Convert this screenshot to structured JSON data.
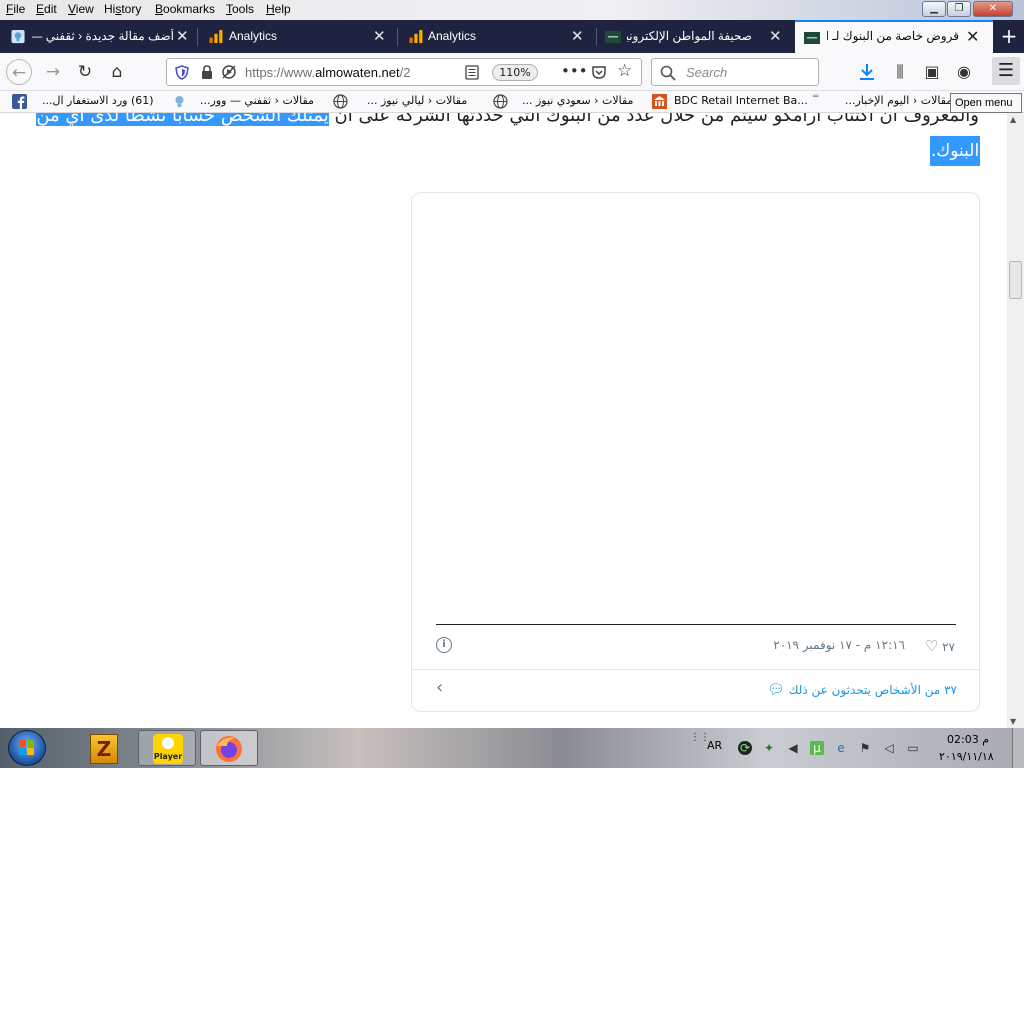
{
  "menubar": {
    "items": [
      {
        "label": "File",
        "underline": "F",
        "rest": "ile"
      },
      {
        "label": "Edit",
        "underline": "E",
        "rest": "dit"
      },
      {
        "label": "View",
        "underline": "V",
        "rest": "iew"
      },
      {
        "label": "History",
        "underline": "s",
        "pre": "Hi",
        "rest": "tory"
      },
      {
        "label": "Bookmarks",
        "underline": "B",
        "rest": "ookmarks"
      },
      {
        "label": "Tools",
        "underline": "T",
        "rest": "ools"
      },
      {
        "label": "Help",
        "underline": "H",
        "rest": "elp"
      }
    ]
  },
  "tabs": [
    {
      "label": "أضف مقالة جديدة ‹ ثقفني — و",
      "icon": "lightbulb-icon"
    },
    {
      "label": "Analytics",
      "icon": "analytics-icon"
    },
    {
      "label": "Analytics",
      "icon": "analytics-icon"
    },
    {
      "label": "صحيفة المواطن الإلكترونية",
      "icon": "almowaten-icon"
    },
    {
      "label": "قروض خاصة من البنوك لـ اكتتا",
      "icon": "almowaten-icon",
      "active": true
    }
  ],
  "navbar": {
    "url_scheme": "https://www.",
    "url_host": "almowaten.net",
    "url_path": "/2",
    "zoom": "110%",
    "search_placeholder": "Search"
  },
  "bookmarks": [
    {
      "label": "(61) ورد الاستغفار ال...",
      "icon": "facebook-icon"
    },
    {
      "label": "مقالات ‹ ثقفني — وور...",
      "icon": "lightbulb-icon"
    },
    {
      "label": "مقالات ‹ ليالي نيوز ...",
      "icon": "globe-icon"
    },
    {
      "label": "مقالات ‹ سعودي نيوز ...",
      "icon": "globe-icon"
    },
    {
      "label": "BDC Retail Internet Ba...",
      "icon": "bank-icon"
    },
    {
      "label": "مقالات ‹ اليوم الإخبار...",
      "icon": "dash-icon"
    }
  ],
  "tooltip": "Open menu",
  "article": {
    "line1_plain": "والمعروف أن اكتتاب أرامكو سيتم من خلال عدد من البنوك التي حددتها الشركة على أن",
    "line1_selected": "يمتلك الشخص حسابا نشطا لدى أي من",
    "line2_selected": "البنوك."
  },
  "tweet": {
    "likes": "٢٧",
    "timestamp": "١٢:١٦ م - ١٧ نوفمبر ٢٠١٩",
    "talking": "٣٧ من الأشخاص يتحدثون عن ذلك"
  },
  "taskbar": {
    "language": "AR",
    "time": "02:03 م",
    "date": "٢٠١٩/١١/١٨",
    "apps": [
      {
        "name": "winzip",
        "label": "Z"
      },
      {
        "name": "player",
        "label": "Player"
      },
      {
        "name": "firefox",
        "label": ""
      }
    ]
  },
  "colors": {
    "tabstrip": "#20233f",
    "accent": "#0a84ff",
    "selection": "#3399ff",
    "tweet_link": "#1b95e0"
  }
}
